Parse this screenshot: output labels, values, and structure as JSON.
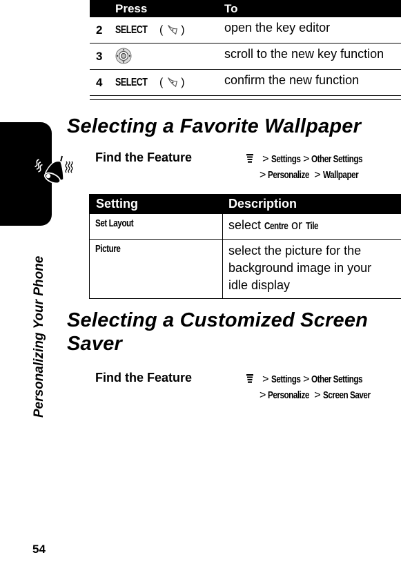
{
  "press_table": {
    "headers": {
      "press": "Press",
      "to": "To"
    },
    "rows": [
      {
        "num": "2",
        "press": "SELECT",
        "press_icon": "right-soft-key-icon",
        "to": "open the key editor"
      },
      {
        "num": "3",
        "press": "",
        "press_icon": "nav-key-icon",
        "to": "scroll to the new key function"
      },
      {
        "num": "4",
        "press": "SELECT",
        "press_icon": "right-soft-key-icon",
        "to": "confirm the new function"
      }
    ]
  },
  "side_tab": {
    "icon": "ringing-bell-icon",
    "label": "Personalizing Your Phone"
  },
  "wallpaper_section": {
    "title": "Selecting a Favorite Wallpaper",
    "find_feature_label": "Find the Feature",
    "path_icon": "menu-key-icon",
    "path": [
      "Settings",
      "Other Settings",
      "Personalize",
      "Wallpaper"
    ],
    "table": {
      "headers": {
        "setting": "Setting",
        "description": "Description"
      },
      "rows": [
        {
          "setting": "Set Layout",
          "desc_prefix": "select ",
          "desc_opt1": "Centre",
          "desc_mid": " or ",
          "desc_opt2": "Tile"
        },
        {
          "setting": "Picture",
          "description": "select the picture for the background image in your idle display"
        }
      ]
    }
  },
  "screensaver_section": {
    "title": "Selecting a Customized Screen Saver",
    "find_feature_label": "Find the Feature",
    "path_icon": "menu-key-icon",
    "path": [
      "Settings",
      "Other Settings",
      "Personalize",
      "Screen Saver"
    ]
  },
  "separator": ">",
  "paren_open": "(",
  "paren_close": ")",
  "page_number": "54"
}
